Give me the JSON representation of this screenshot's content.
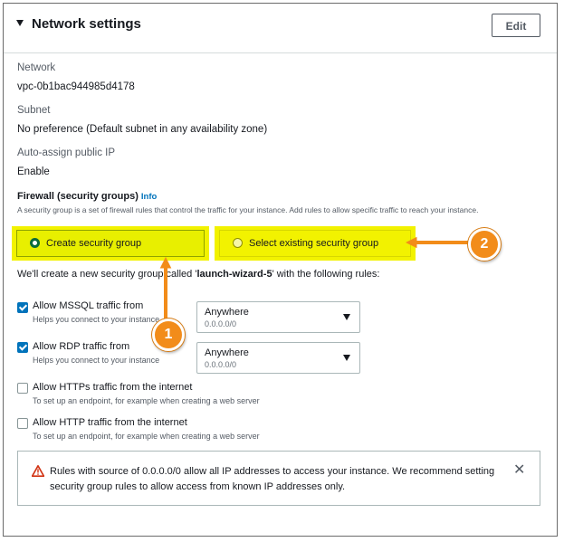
{
  "section": {
    "title": "Network settings",
    "edit_label": "Edit"
  },
  "fields": [
    {
      "label": "Network",
      "value": "vpc-0b1bac944985d4178"
    },
    {
      "label": "Subnet",
      "value": "No preference (Default subnet in any availability zone)"
    },
    {
      "label": "Auto-assign public IP",
      "value": "Enable"
    }
  ],
  "firewall": {
    "title": "Firewall (security groups)",
    "info_label": "Info",
    "description": "A security group is a set of firewall rules that control the traffic for your instance. Add rules to allow specific traffic to reach your instance.",
    "options": [
      {
        "label": "Create security group",
        "selected": true
      },
      {
        "label": "Select existing security group",
        "selected": false
      }
    ],
    "rules_intro_prefix": "We'll create a new security group called '",
    "group_name": "launch-wizard-5",
    "rules_intro_suffix": "' with the following rules:"
  },
  "rules": [
    {
      "label": "Allow MSSQL traffic from",
      "help": "Helps you connect to your instance",
      "checked": true,
      "source": "Anywhere",
      "cidr": "0.0.0.0/0"
    },
    {
      "label": "Allow RDP traffic from",
      "help": "Helps you connect to your instance",
      "checked": true,
      "source": "Anywhere",
      "cidr": "0.0.0.0/0"
    },
    {
      "label": "Allow HTTPs traffic from the internet",
      "help": "To set up an endpoint, for example when creating a web server",
      "checked": false
    },
    {
      "label": "Allow HTTP traffic from the internet",
      "help": "To set up an endpoint, for example when creating a web server",
      "checked": false
    }
  ],
  "alert": {
    "icon": "warning-icon",
    "text": "Rules with source of 0.0.0.0/0 allow all IP addresses to access your instance. We recommend setting security group rules to allow access from known IP addresses only."
  },
  "annotations": [
    {
      "number": "1"
    },
    {
      "number": "2"
    }
  ],
  "colors": {
    "highlight": "#f2f200",
    "callout": "#f28c1a",
    "link": "#0073bb",
    "warning": "#d13212"
  }
}
